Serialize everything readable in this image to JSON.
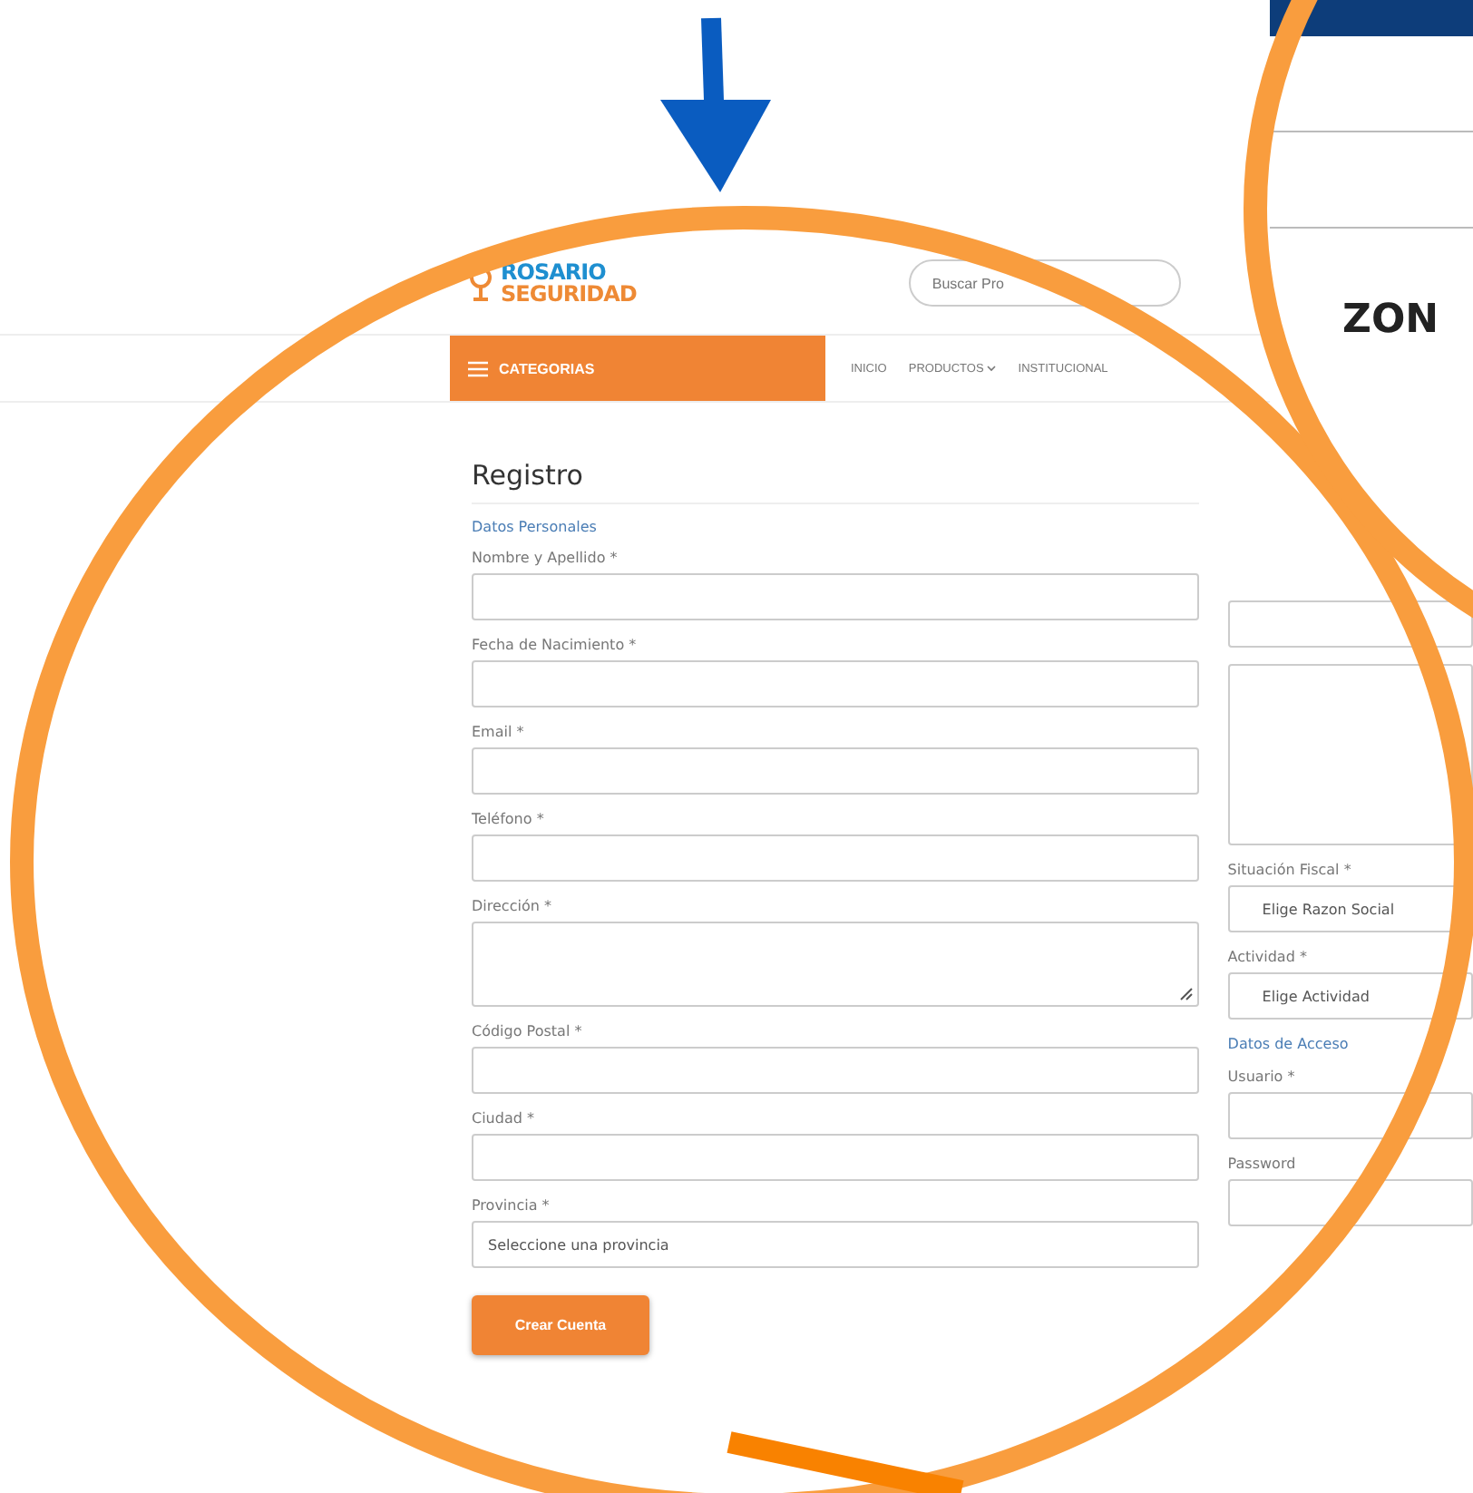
{
  "header": {
    "logo": {
      "line1": "ROSARIO",
      "line2": "SEGURIDAD"
    },
    "search": {
      "placeholder": "Buscar Pro"
    }
  },
  "nav": {
    "categories": "CATEGORIAS",
    "items": [
      {
        "label": "INICIO",
        "dropdown": false
      },
      {
        "label": "PRODUCTOS",
        "dropdown": true
      },
      {
        "label": "INSTITUCIONAL",
        "dropdown": false
      }
    ]
  },
  "inset": {
    "heading": "ZON"
  },
  "form": {
    "title": "Registro",
    "section": "Datos Personales",
    "fields": [
      {
        "kind": "input",
        "label": "Nombre y Apellido *"
      },
      {
        "kind": "input",
        "label": "Fecha de Nacimiento *"
      },
      {
        "kind": "input",
        "label": "Email *"
      },
      {
        "kind": "input",
        "label": "Teléfono *"
      },
      {
        "kind": "textarea",
        "label": "Dirección *"
      },
      {
        "kind": "input",
        "label": "Código Postal *"
      },
      {
        "kind": "input",
        "label": "Ciudad *"
      },
      {
        "kind": "select",
        "label": "Provincia *",
        "placeholder": "Seleccione una provincia"
      }
    ],
    "right_fields": [
      {
        "kind": "input"
      },
      {
        "kind": "textarea"
      },
      {
        "kind": "select",
        "label": "Situación Fiscal *",
        "placeholder": "Elige Razon Social"
      },
      {
        "kind": "select",
        "label": "Actividad *",
        "placeholder": "Elige Actividad"
      },
      {
        "kind": "section",
        "label": "Datos de Acceso"
      },
      {
        "kind": "input",
        "label": "Usuario *"
      },
      {
        "kind": "input",
        "label": "Password"
      }
    ],
    "submit": "Crear Cuenta"
  }
}
